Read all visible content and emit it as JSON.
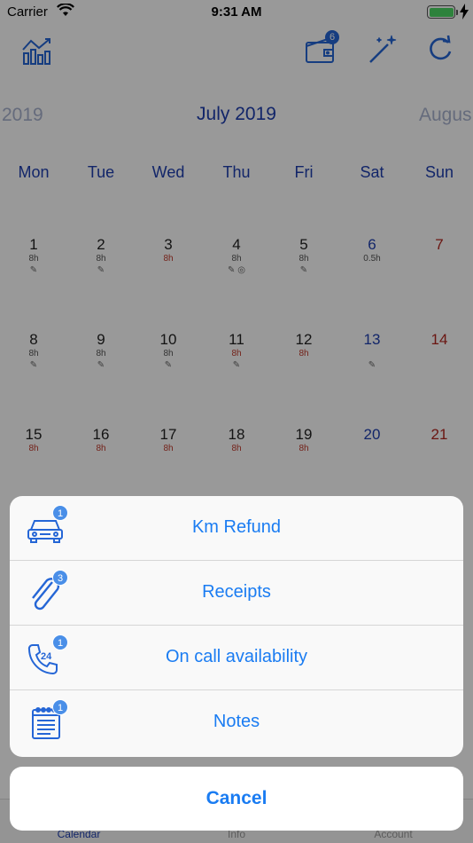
{
  "status": {
    "carrier": "Carrier",
    "time": "9:31 AM"
  },
  "toolbar": {
    "wallet_badge": "6"
  },
  "month": {
    "prev": "2019",
    "current": "July 2019",
    "next": "Augus"
  },
  "weekdays": [
    "Mon",
    "Tue",
    "Wed",
    "Thu",
    "Fri",
    "Sat",
    "Sun"
  ],
  "weeks": [
    [
      {
        "num": "1",
        "hours": "8h",
        "hours_red": false,
        "icons": "✎"
      },
      {
        "num": "2",
        "hours": "8h",
        "hours_red": false,
        "icons": "✎"
      },
      {
        "num": "3",
        "hours": "8h",
        "hours_red": true,
        "icons": ""
      },
      {
        "num": "4",
        "hours": "8h",
        "hours_red": false,
        "icons": "✎ ◎"
      },
      {
        "num": "5",
        "hours": "8h",
        "hours_red": false,
        "icons": "✎"
      },
      {
        "num": "6",
        "hours": "0.5h",
        "hours_red": false,
        "icons": ""
      },
      {
        "num": "7",
        "hours": "",
        "hours_red": false,
        "icons": ""
      }
    ],
    [
      {
        "num": "8",
        "hours": "8h",
        "hours_red": false,
        "icons": "✎"
      },
      {
        "num": "9",
        "hours": "8h",
        "hours_red": false,
        "icons": "✎"
      },
      {
        "num": "10",
        "hours": "8h",
        "hours_red": false,
        "icons": "✎"
      },
      {
        "num": "11",
        "hours": "8h",
        "hours_red": true,
        "icons": "✎"
      },
      {
        "num": "12",
        "hours": "8h",
        "hours_red": true,
        "icons": ""
      },
      {
        "num": "13",
        "hours": "",
        "hours_red": false,
        "icons": "✎"
      },
      {
        "num": "14",
        "hours": "",
        "hours_red": false,
        "icons": ""
      }
    ],
    [
      {
        "num": "15",
        "hours": "8h",
        "hours_red": true,
        "icons": ""
      },
      {
        "num": "16",
        "hours": "8h",
        "hours_red": true,
        "icons": ""
      },
      {
        "num": "17",
        "hours": "8h",
        "hours_red": true,
        "icons": ""
      },
      {
        "num": "18",
        "hours": "8h",
        "hours_red": true,
        "icons": ""
      },
      {
        "num": "19",
        "hours": "8h",
        "hours_red": true,
        "icons": ""
      },
      {
        "num": "20",
        "hours": "",
        "hours_red": false,
        "icons": ""
      },
      {
        "num": "21",
        "hours": "",
        "hours_red": false,
        "icons": ""
      }
    ]
  ],
  "sheet": {
    "items": [
      {
        "label": "Km Refund",
        "badge": "1",
        "icon": "car-icon"
      },
      {
        "label": "Receipts",
        "badge": "3",
        "icon": "paperclip-icon"
      },
      {
        "label": "On call availability",
        "badge": "1",
        "icon": "phone-24-icon"
      },
      {
        "label": "Notes",
        "badge": "1",
        "icon": "notepad-icon"
      }
    ],
    "cancel_label": "Cancel"
  },
  "tabbar": {
    "calendar": "Calendar",
    "info": "Info",
    "account": "Account"
  },
  "colors": {
    "accent": "#1a7cf2",
    "calendar_blue": "#1e3fb0",
    "weekend_red": "#b3261e",
    "badge": "#4a8fe8"
  }
}
